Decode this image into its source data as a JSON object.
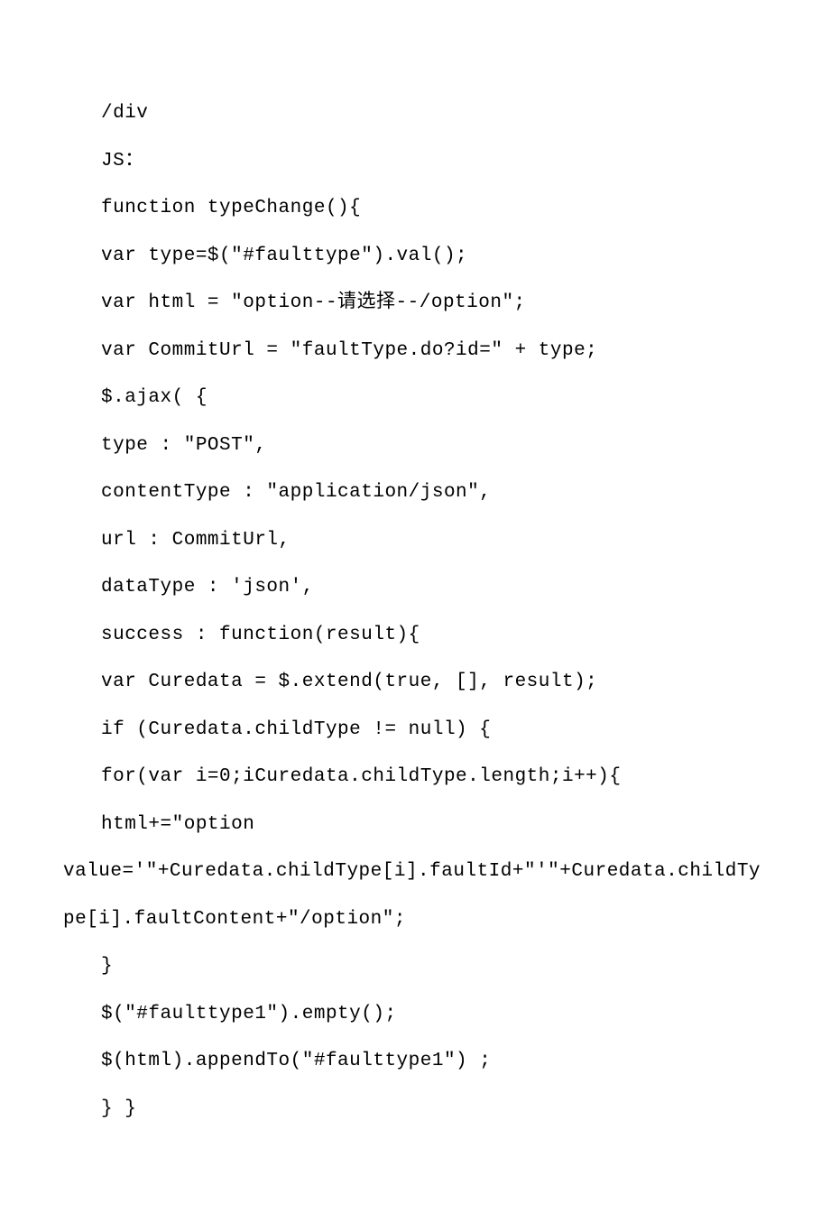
{
  "lines": [
    {
      "text": "/div",
      "indent": true
    },
    {
      "text": "JS：",
      "indent": true
    },
    {
      "text": "function typeChange(){",
      "indent": true
    },
    {
      "text": "var type=$(\"#faulttype\").val();",
      "indent": true
    },
    {
      "text": "var html = \"option--请选择--/option\";",
      "indent": true
    },
    {
      "text": "var CommitUrl = \"faultType.do?id=\" + type;",
      "indent": true
    },
    {
      "text": "$.ajax( {",
      "indent": true
    },
    {
      "text": "type : \"POST\",",
      "indent": true
    },
    {
      "text": "contentType : \"application/json\",",
      "indent": true
    },
    {
      "text": "url : CommitUrl,",
      "indent": true
    },
    {
      "text": "dataType : 'json',",
      "indent": true
    },
    {
      "text": "success : function(result){",
      "indent": true
    },
    {
      "text": "var Curedata = $.extend(true, [], result);",
      "indent": true
    },
    {
      "text": "if (Curedata.childType != null) {",
      "indent": true
    },
    {
      "text": "for(var i=0;iCuredata.childType.length;i++){",
      "indent": true
    },
    {
      "text": "html+=\"option",
      "indent": true
    },
    {
      "text": "value='\"+Curedata.childType[i].faultId+\"'\"+Curedata.childType[i].faultContent+\"/option\";",
      "indent": false
    },
    {
      "text": "}",
      "indent": true
    },
    {
      "text": "$(\"#faulttype1\").empty();",
      "indent": true
    },
    {
      "text": "$(html).appendTo(\"#faulttype1\") ;",
      "indent": true
    },
    {
      "text": "} }",
      "indent": true
    }
  ]
}
